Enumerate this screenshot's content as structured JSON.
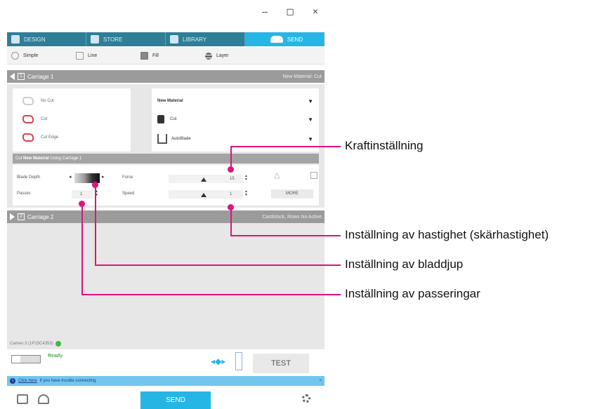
{
  "window_controls": {
    "minimize": "–",
    "maximize": "◻",
    "close": "×"
  },
  "tabs": [
    {
      "label": "DESIGN",
      "icon": "design-icon"
    },
    {
      "label": "STORE",
      "icon": "store-icon"
    },
    {
      "label": "LIBRARY",
      "icon": "library-icon"
    },
    {
      "label": "SEND",
      "icon": "cutter-icon",
      "active": true
    }
  ],
  "modes": [
    {
      "label": "Simple",
      "icon": "radio-icon"
    },
    {
      "label": "Line",
      "icon": "line-icon"
    },
    {
      "label": "Fill",
      "icon": "fill-icon"
    },
    {
      "label": "Layer",
      "icon": "layer-icon"
    }
  ],
  "carriage1": {
    "number": "1",
    "label": "Carriage 1",
    "right_text": "New Material: Cut"
  },
  "cut_options": [
    "No Cut",
    "Cut",
    "Cut Edge"
  ],
  "material": {
    "name": "New Material",
    "action": "Cut",
    "blade": "AutoBlade"
  },
  "cut_header": {
    "prefix": "Cut",
    "material": "New Material",
    "suffix": "Using Carriage 1"
  },
  "settings": {
    "blade_depth_label": "Blade Depth",
    "blade_depth_value": "1",
    "force_label": "Force",
    "force_value": "15",
    "passes_label": "Passes",
    "passes_value": "1",
    "speed_label": "Speed",
    "speed_value": "1",
    "more_label": "MORE"
  },
  "carriage2": {
    "number": "2",
    "label": "Carriage 2",
    "right_text": "Cardstock, Rows No Active"
  },
  "status": {
    "device": "Cameo 3 (1P15C4353)"
  },
  "ready": {
    "text": "Ready",
    "test_label": "TEST"
  },
  "help": {
    "link": "Click here",
    "text": "if you have trouble connecting"
  },
  "bottom": {
    "send_label": "SEND"
  },
  "callouts": {
    "force": "Kraftinställning",
    "speed": "Inställning av hastighet (skärhastighet)",
    "depth": "Inställning av bladdjup",
    "passes": "Inställning av passeringar"
  },
  "colors": {
    "accent": "#25b6e6",
    "tab_bar": "#2f7e97",
    "callout": "#e0137d"
  }
}
